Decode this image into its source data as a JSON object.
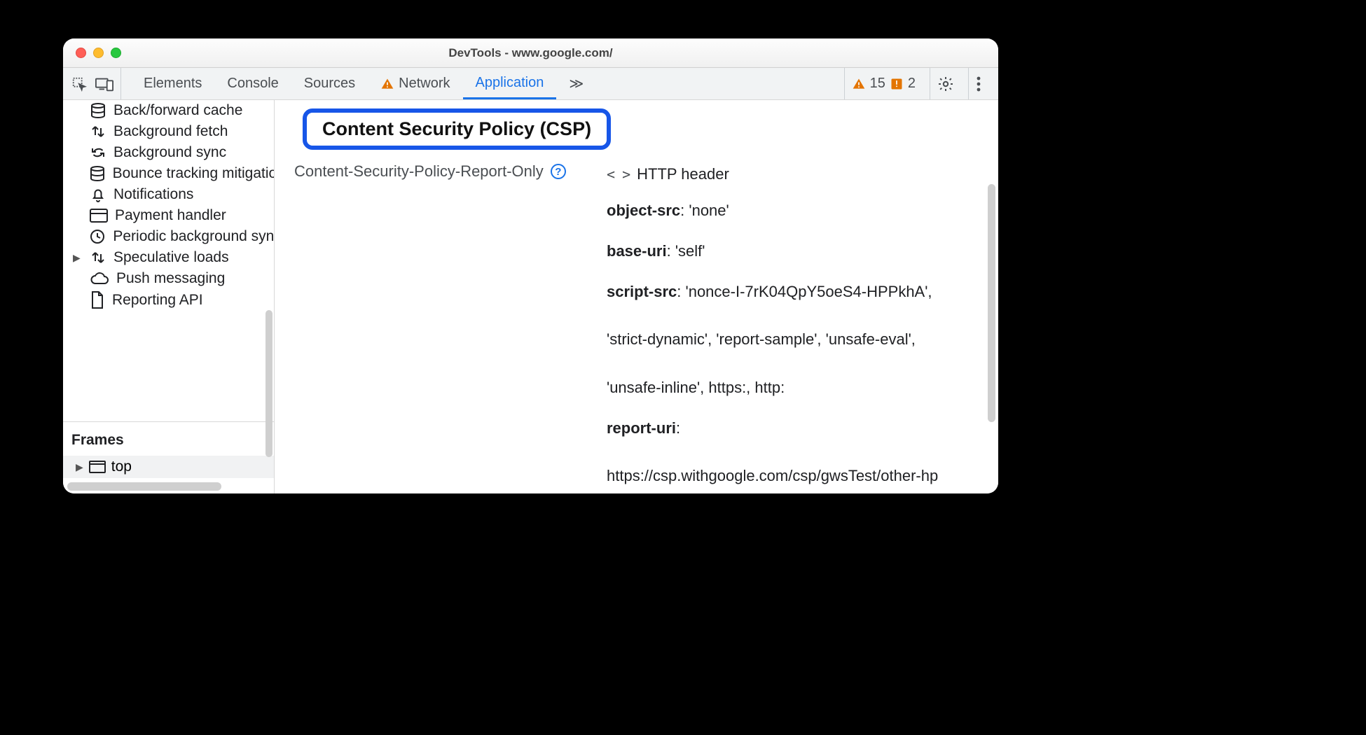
{
  "window": {
    "title": "DevTools - www.google.com/"
  },
  "tabstrip": {
    "tabs": [
      "Elements",
      "Console",
      "Sources",
      "Network",
      "Application"
    ],
    "active": "Application",
    "overflow_glyph": "≫",
    "warnings_count": "15",
    "issues_count": "2"
  },
  "sidebar": {
    "items": [
      {
        "label": "Back/forward cache",
        "icon": "database"
      },
      {
        "label": "Background fetch",
        "icon": "updown"
      },
      {
        "label": "Background sync",
        "icon": "sync"
      },
      {
        "label": "Bounce tracking mitigations",
        "icon": "database"
      },
      {
        "label": "Notifications",
        "icon": "bell"
      },
      {
        "label": "Payment handler",
        "icon": "card"
      },
      {
        "label": "Periodic background sync",
        "icon": "clock"
      },
      {
        "label": "Speculative loads",
        "icon": "updown",
        "expandable": true
      },
      {
        "label": "Push messaging",
        "icon": "cloud"
      },
      {
        "label": "Reporting API",
        "icon": "doc"
      }
    ],
    "frames_header": "Frames",
    "frames_top": "top"
  },
  "main": {
    "section_title": "Content Security Policy (CSP)",
    "header_name": "Content-Security-Policy-Report-Only",
    "source_label": "HTTP header",
    "directives": [
      {
        "name": "object-src",
        "value": "'none'"
      },
      {
        "name": "base-uri",
        "value": "'self'"
      },
      {
        "name": "script-src",
        "value": "'nonce-I-7rK04QpY5oeS4-HPPkhA', 'strict-dynamic', 'report-sample', 'unsafe-eval', 'unsafe-inline', https:, http:"
      },
      {
        "name": "report-uri",
        "value": "https://csp.withgoogle.com/csp/gwsTest/other-hp"
      }
    ]
  }
}
